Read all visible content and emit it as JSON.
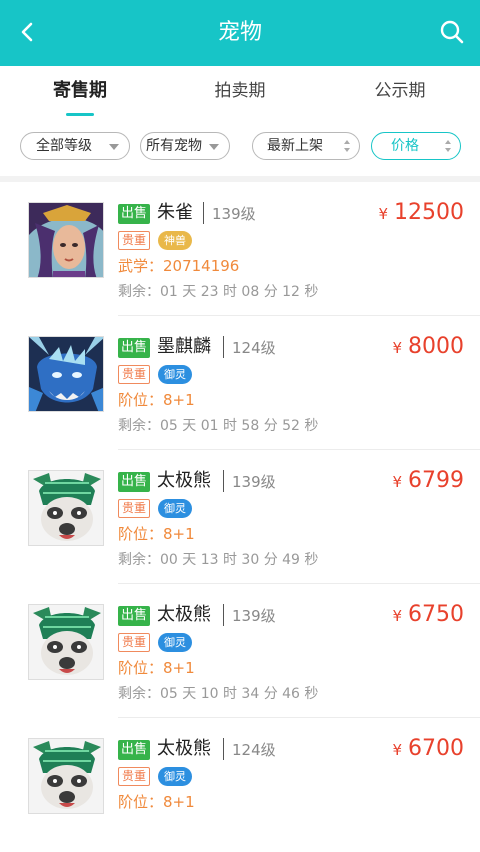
{
  "header": {
    "title": "宠物"
  },
  "tabs": [
    {
      "label": "寄售期",
      "active": true
    },
    {
      "label": "拍卖期",
      "active": false
    },
    {
      "label": "公示期",
      "active": false
    }
  ],
  "filters": {
    "level": "全部等级",
    "pet_type": "所有宠物",
    "sort_new": "最新上架",
    "sort_price": "价格"
  },
  "colors": {
    "brand": "#17c5c7",
    "price": "#e8412c",
    "sale_tag": "#36b34a",
    "rare_tag": "#f08a5d"
  },
  "items": [
    {
      "sale_tag": "出售",
      "name": "朱雀",
      "level": "139级",
      "currency": "¥",
      "price": "12500",
      "rare_tag": "贵重",
      "type_tag": "神兽",
      "type_color": "#e9b84a",
      "attr": "武学：20714196",
      "remaining": "剩余：01 天 23 时 08 分 12 秒",
      "avatar": "zhuque-portrait"
    },
    {
      "sale_tag": "出售",
      "name": "墨麒麟",
      "level": "124级",
      "currency": "¥",
      "price": "8000",
      "rare_tag": "贵重",
      "type_tag": "御灵",
      "type_color": "#2c8fe0",
      "attr": "阶位：8+1",
      "remaining": "剩余：05 天 01 时 58 分 52 秒",
      "avatar": "qilin-portrait"
    },
    {
      "sale_tag": "出售",
      "name": "太极熊",
      "level": "139级",
      "currency": "¥",
      "price": "6799",
      "rare_tag": "贵重",
      "type_tag": "御灵",
      "type_color": "#2c8fe0",
      "attr": "阶位：8+1",
      "remaining": "剩余：00 天 13 时 30 分 49 秒",
      "avatar": "bear-portrait"
    },
    {
      "sale_tag": "出售",
      "name": "太极熊",
      "level": "139级",
      "currency": "¥",
      "price": "6750",
      "rare_tag": "贵重",
      "type_tag": "御灵",
      "type_color": "#2c8fe0",
      "attr": "阶位：8+1",
      "remaining": "剩余：05 天 10 时 34 分 46 秒",
      "avatar": "bear-portrait"
    },
    {
      "sale_tag": "出售",
      "name": "太极熊",
      "level": "124级",
      "currency": "¥",
      "price": "6700",
      "rare_tag": "贵重",
      "type_tag": "御灵",
      "type_color": "#2c8fe0",
      "attr": "阶位：8+1",
      "remaining": "",
      "avatar": "bear-portrait"
    }
  ]
}
